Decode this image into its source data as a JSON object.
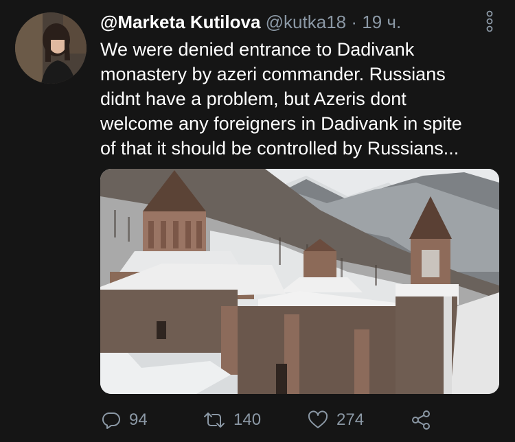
{
  "tweet": {
    "display_name": "@Marketa Kutilova",
    "handle": "@kutka18",
    "separator": "·",
    "time": "19 ч.",
    "text_lines": [
      "We were denied entrance to Dadivank",
      "monastery by azeri commander. Russians",
      "didnt have a problem, but Azeris dont",
      "welcome any foreigners in Dadivank in spite",
      "of that it should be controlled by Russians..."
    ]
  },
  "actions": {
    "reply_count": "94",
    "retweet_count": "140",
    "like_count": "274"
  },
  "icons": {
    "more": "more-vertical-icon",
    "reply": "reply-icon",
    "retweet": "retweet-icon",
    "like": "heart-icon",
    "share": "share-icon"
  },
  "colors": {
    "background": "#151515",
    "text": "#ffffff",
    "muted": "#8b98a5"
  }
}
